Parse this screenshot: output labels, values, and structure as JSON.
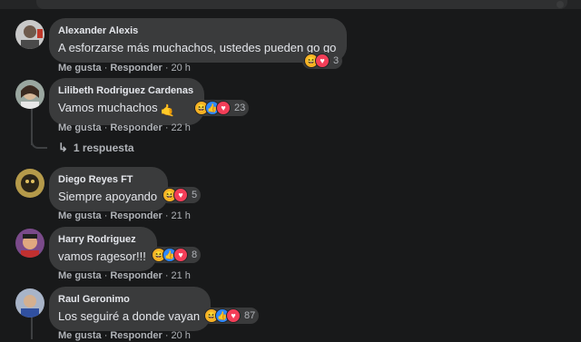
{
  "reaction_icons": {
    "haha": "😆",
    "like": "👍",
    "love": "♥"
  },
  "actions_labels": {
    "like": "Me gusta",
    "reply": "Responder",
    "separator": "·"
  },
  "comments": [
    {
      "author": "Alexander Alexis",
      "text": "A esforzarse más muchachos, ustedes pueden go go",
      "emoji": "",
      "reactions": [
        "haha",
        "love"
      ],
      "reaction_count": "3",
      "time": "20 h"
    },
    {
      "author": "Lilibeth Rodriguez Cardenas",
      "text": "Vamos muchachos",
      "emoji": "🤙",
      "reactions": [
        "haha",
        "like",
        "love"
      ],
      "reaction_count": "23",
      "time": "22 h",
      "replies_label": "1 respuesta"
    },
    {
      "author": "Diego Reyes FT",
      "text": "Siempre apoyando",
      "emoji": "",
      "reactions": [
        "haha",
        "love"
      ],
      "reaction_count": "5",
      "time": "21 h"
    },
    {
      "author": "Harry Rodriguez",
      "text": "vamos ragesor!!!",
      "emoji": "",
      "reactions": [
        "haha",
        "like",
        "love"
      ],
      "reaction_count": "8",
      "time": "21 h"
    },
    {
      "author": "Raul Geronimo",
      "text": "Los seguiré a donde vayan",
      "emoji": "",
      "reactions": [
        "haha",
        "like",
        "love"
      ],
      "reaction_count": "87",
      "time": "20 h"
    }
  ],
  "colors": {
    "background": "#18191a",
    "bubble": "#3a3b3c",
    "text": "#e4e6eb",
    "muted": "#b0b3b8",
    "like": "#2d88ff",
    "love": "#f33e58",
    "haha": "#f7b125"
  }
}
